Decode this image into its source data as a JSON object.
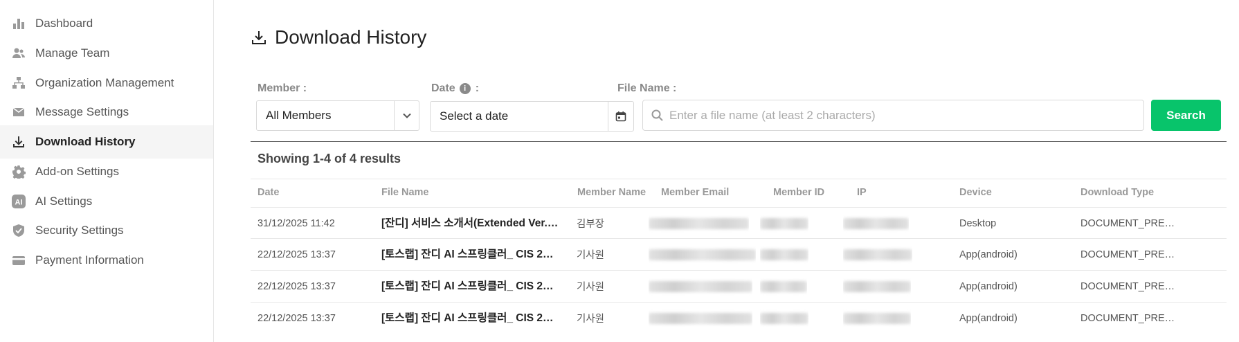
{
  "sidebar": {
    "items": [
      {
        "label": "Dashboard",
        "icon": "bar-chart-icon"
      },
      {
        "label": "Manage Team",
        "icon": "team-icon"
      },
      {
        "label": "Organization Management",
        "icon": "org-chart-icon"
      },
      {
        "label": "Message Settings",
        "icon": "envelope-icon"
      },
      {
        "label": "Download History",
        "icon": "download-icon",
        "active": true
      },
      {
        "label": "Add-on Settings",
        "icon": "gear-icon"
      },
      {
        "label": "AI Settings",
        "icon": "ai-icon"
      },
      {
        "label": "Security Settings",
        "icon": "shield-icon"
      },
      {
        "label": "Payment Information",
        "icon": "card-icon"
      }
    ]
  },
  "page": {
    "title": "Download History"
  },
  "filters": {
    "member_label": "Member :",
    "member_value": "All Members",
    "date_label": "Date",
    "date_label_suffix": ":",
    "date_value": "Select a date",
    "file_label": "File Name :",
    "file_placeholder": "Enter a file name (at least 2 characters)",
    "search_label": "Search"
  },
  "results": {
    "summary": "Showing 1-4 of 4 results"
  },
  "table": {
    "columns": [
      "Date",
      "File Name",
      "Member Name",
      "Member Email",
      "Member ID",
      "IP",
      "Device",
      "Download Type"
    ],
    "rows": [
      {
        "date": "31/12/2025 11:42",
        "file": "[잔디] 서비스 소개서(Extended Ver.…",
        "member": "김부장",
        "device": "Desktop",
        "type": "DOCUMENT_PRE…"
      },
      {
        "date": "22/12/2025 13:37",
        "file": "[토스랩] 잔디 AI 스프링클러_ CIS 2…",
        "member": "기사원",
        "device": "App(android)",
        "type": "DOCUMENT_PRE…"
      },
      {
        "date": "22/12/2025 13:37",
        "file": "[토스랩] 잔디 AI 스프링클러_ CIS 2…",
        "member": "기사원",
        "device": "App(android)",
        "type": "DOCUMENT_PRE…"
      },
      {
        "date": "22/12/2025 13:37",
        "file": "[토스랩] 잔디 AI 스프링클러_ CIS 2…",
        "member": "기사원",
        "device": "App(android)",
        "type": "DOCUMENT_PRE…"
      }
    ]
  },
  "colors": {
    "accent": "#08c46b",
    "active_bg": "#f5f5f5"
  }
}
